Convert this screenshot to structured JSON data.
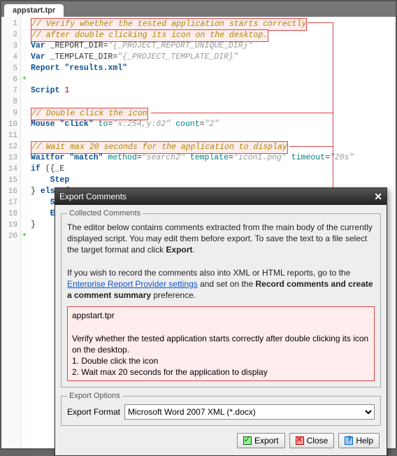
{
  "tab": {
    "title": "appstart.tpr"
  },
  "code": {
    "lines": [
      "// Verify whether the tested application starts correctly",
      "// after double clicking its icon on the desktop.",
      "Var _REPORT_DIR=\"{_PROJECT_REPORT_UNIQUE_DIR}\"",
      "Var _TEMPLATE_DIR=\"{_PROJECT_TEMPLATE_DIR}\"",
      "Report \"results.xml\"",
      "",
      "Script 1",
      "",
      "// Double click the icon",
      "Mouse \"click\" to=\"x:254,y:62\" count=\"2\"",
      "",
      "// Wait max 20 seconds for the application to display",
      "Waitfor \"match\" method=\"search2\" template=\"icon1.png\" timeout=\"20s\"",
      "if ({_E",
      "    Step",
      "} else {",
      "    Step",
      "    Exit",
      "}",
      ""
    ],
    "gutter": [
      "1",
      "2",
      "3",
      "4",
      "5",
      "6",
      "7",
      "8",
      "9",
      "10",
      "11",
      "12",
      "13",
      "14",
      "15",
      "16",
      "17",
      "18",
      "19",
      "20"
    ]
  },
  "dialog": {
    "title": "Export Comments",
    "close_glyph": "✕",
    "collected_legend": "Collected Comments",
    "intro_p1a": "The editor below contains comments extracted from the main body of the currently displayed script. You may edit them before export. To save the text to a file select the target format and click ",
    "intro_p1b": "Export",
    "intro_p1c": ".",
    "intro_p2a": "If you wish to record the comments also into XML or HTML reports, go to the ",
    "intro_link": "Enterprise Report Provider settings",
    "intro_p2b": " and set on the ",
    "intro_bold2": "Record comments and create a comment summary",
    "intro_p2c": " preference.",
    "comments_title": "appstart.tpr",
    "comments_body1": "Verify whether the tested application starts correctly after double clicking its icon on the desktop.",
    "comments_body2": "1. Double click the icon",
    "comments_body3": "2. Wait max 20 seconds for the application to display",
    "options_legend": "Export Options",
    "format_label": "Export Format",
    "format_value": "Microsoft Word 2007 XML (*.docx)",
    "btn_export": "Export",
    "btn_close": "Close",
    "btn_help": "Help"
  }
}
